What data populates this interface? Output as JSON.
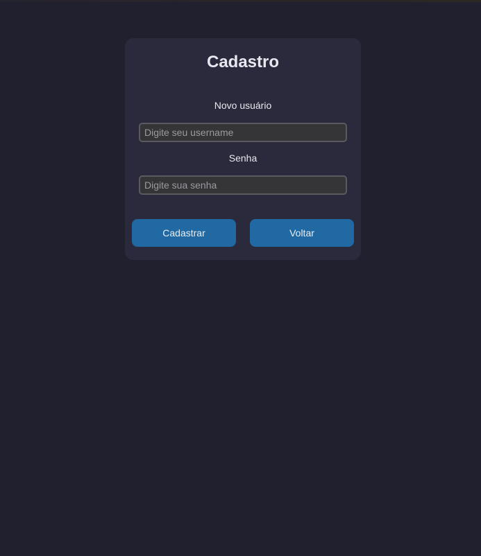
{
  "form": {
    "title": "Cadastro",
    "username_label": "Novo usuário",
    "username_placeholder": "Digite seu username",
    "username_value": "",
    "password_label": "Senha",
    "password_placeholder": "Digite sua senha",
    "password_value": "",
    "register_button": "Cadastrar",
    "back_button": "Voltar"
  },
  "colors": {
    "background": "#21202f",
    "card": "#2b2a3c",
    "button": "#2069a3",
    "input": "#353537",
    "input_border": "#5a5a60"
  }
}
